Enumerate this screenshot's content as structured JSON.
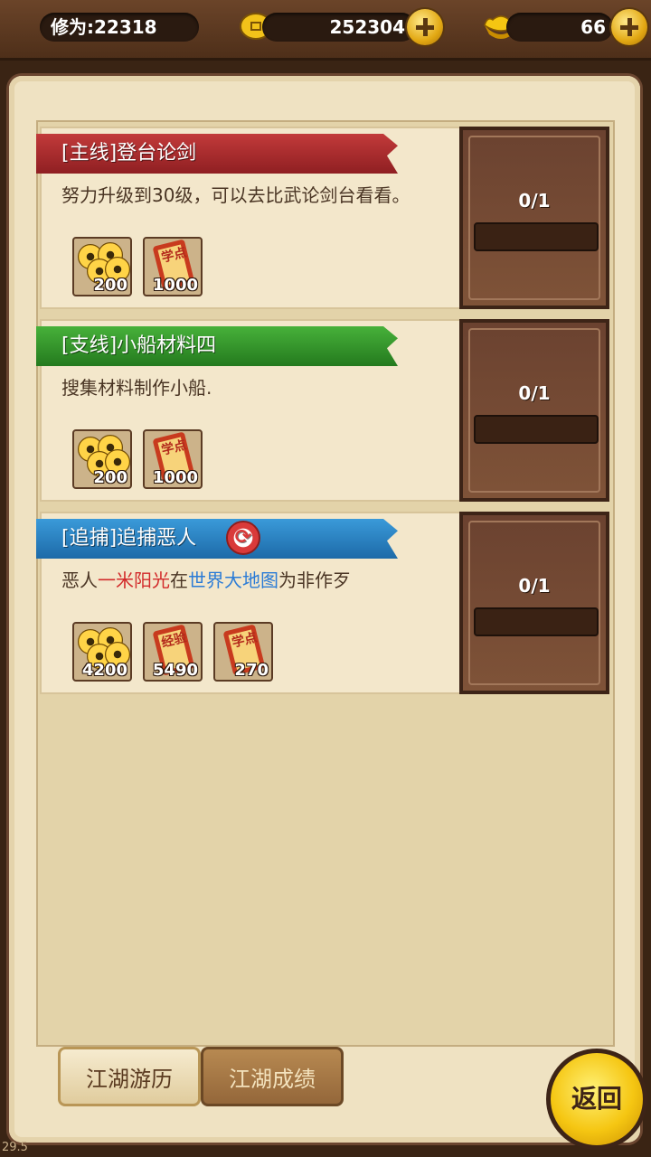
{
  "header": {
    "cultivation": "修为:22318",
    "coins": "252304",
    "ingots": "66"
  },
  "quests": [
    {
      "title": "[主线]登台论剑",
      "color": "#b3292d",
      "description_parts": [
        {
          "text": "努力升级到30级，可以去比武论剑台看看。",
          "style": ""
        }
      ],
      "progress": "0/1",
      "progress_fraction": 0,
      "rewards": [
        {
          "icon": "copper-coins-icon",
          "count": "200"
        },
        {
          "icon": "study-points-scroll-icon",
          "count": "1000",
          "glyph": "学点"
        }
      ]
    },
    {
      "title": "[支线]小船材料四",
      "color": "#2f9a29",
      "description_parts": [
        {
          "text": "搜集材料制作小船.",
          "style": ""
        }
      ],
      "progress": "0/1",
      "progress_fraction": 0,
      "rewards": [
        {
          "icon": "copper-coins-icon",
          "count": "200"
        },
        {
          "icon": "study-points-scroll-icon",
          "count": "1000",
          "glyph": "学点"
        }
      ]
    },
    {
      "title": "[追捕]追捕恶人",
      "color": "#2a82c4",
      "description_parts": [
        {
          "text": "恶人",
          "style": ""
        },
        {
          "text": "一米阳光",
          "style": "red"
        },
        {
          "text": "在",
          "style": ""
        },
        {
          "text": "世界大地图",
          "style": "blue"
        },
        {
          "text": "为非作歹",
          "style": ""
        }
      ],
      "progress": "0/1",
      "progress_fraction": 0,
      "rewards": [
        {
          "icon": "copper-coins-icon",
          "count": "4200"
        },
        {
          "icon": "experience-scroll-icon",
          "count": "5490",
          "glyph": "经验"
        },
        {
          "icon": "study-points-scroll-icon",
          "count": "270",
          "glyph": "学点"
        }
      ]
    }
  ],
  "tabs": {
    "active": "江湖游历",
    "inactive": "江湖成绩"
  },
  "back_label": "返回",
  "fps": "29.5"
}
